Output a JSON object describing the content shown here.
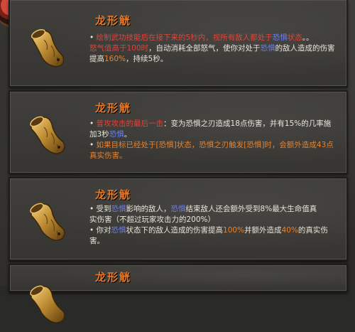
{
  "items": [
    {
      "name": "龙形觥",
      "lines": [
        {
          "bullet": "• ",
          "segments": [
            {
              "t": "绘制武功技能后在接下来的5秒内",
              "c": "red"
            },
            {
              "t": "，视所有敌人都处于",
              "c": "red"
            },
            {
              "t": "恐惧",
              "c": "blue"
            },
            {
              "t": "状态",
              "c": "red"
            },
            {
              "t": "。。",
              "c": ""
            }
          ]
        },
        {
          "bullet": "",
          "segments": [
            {
              "t": "怒气值高于100时",
              "c": "red"
            },
            {
              "t": "，自动消耗全部怒气，使你对处于",
              "c": ""
            },
            {
              "t": "恐惧",
              "c": "blue"
            },
            {
              "t": "的敌人造成的伤害",
              "c": ""
            }
          ]
        },
        {
          "bullet": "",
          "segments": [
            {
              "t": "提高",
              "c": ""
            },
            {
              "t": "160%",
              "c": "orange"
            },
            {
              "t": "，持续5秒。",
              "c": ""
            }
          ]
        }
      ]
    },
    {
      "name": "龙形觥",
      "lines": [
        {
          "bullet": "• ",
          "segments": [
            {
              "t": "普攻攻击的最后一击",
              "c": "red"
            },
            {
              "t": "：变为恐惧之刃造成18点伤害，并有15%的几率施",
              "c": ""
            }
          ]
        },
        {
          "bullet": "",
          "segments": [
            {
              "t": "加3秒",
              "c": ""
            },
            {
              "t": "恐惧",
              "c": "blue"
            },
            {
              "t": "。",
              "c": ""
            }
          ]
        },
        {
          "bullet": "• ",
          "segments": [
            {
              "t": "如果目标已经处于[恐惧]状态，恐惧之刃触发[恐惧]时，会额外造成43点",
              "c": "orange"
            }
          ]
        },
        {
          "bullet": "",
          "segments": [
            {
              "t": "真实伤害。",
              "c": "orange"
            }
          ]
        }
      ]
    },
    {
      "name": "龙形觥",
      "lines": [
        {
          "bullet": "• ",
          "segments": [
            {
              "t": "受到",
              "c": ""
            },
            {
              "t": "恐惧",
              "c": "blue"
            },
            {
              "t": "影响的敌人，",
              "c": ""
            },
            {
              "t": "恐惧",
              "c": "blue"
            },
            {
              "t": "结束敌人还会额外受到8%最大生命值真",
              "c": ""
            }
          ]
        },
        {
          "bullet": "",
          "segments": [
            {
              "t": "实伤害（不超过玩家攻击力的200%）",
              "c": ""
            }
          ]
        },
        {
          "bullet": "• ",
          "segments": [
            {
              "t": "你对",
              "c": ""
            },
            {
              "t": "恐惧",
              "c": "blue"
            },
            {
              "t": "状态下的敌人造成的伤害提高",
              "c": ""
            },
            {
              "t": "100%",
              "c": "orange"
            },
            {
              "t": "并额外造成",
              "c": ""
            },
            {
              "t": "40%",
              "c": "orange"
            },
            {
              "t": "的真实伤",
              "c": ""
            }
          ]
        },
        {
          "bullet": "",
          "segments": [
            {
              "t": "害。",
              "c": ""
            }
          ]
        }
      ]
    },
    {
      "name": "龙形觥",
      "lines": []
    }
  ],
  "icon": "dragon-horn-cup-icon",
  "colors": {
    "title": "#e6792a",
    "red": "#e0443a",
    "blue": "#6a7ff0",
    "orange": "#e8822d",
    "text": "#e8e4da"
  }
}
